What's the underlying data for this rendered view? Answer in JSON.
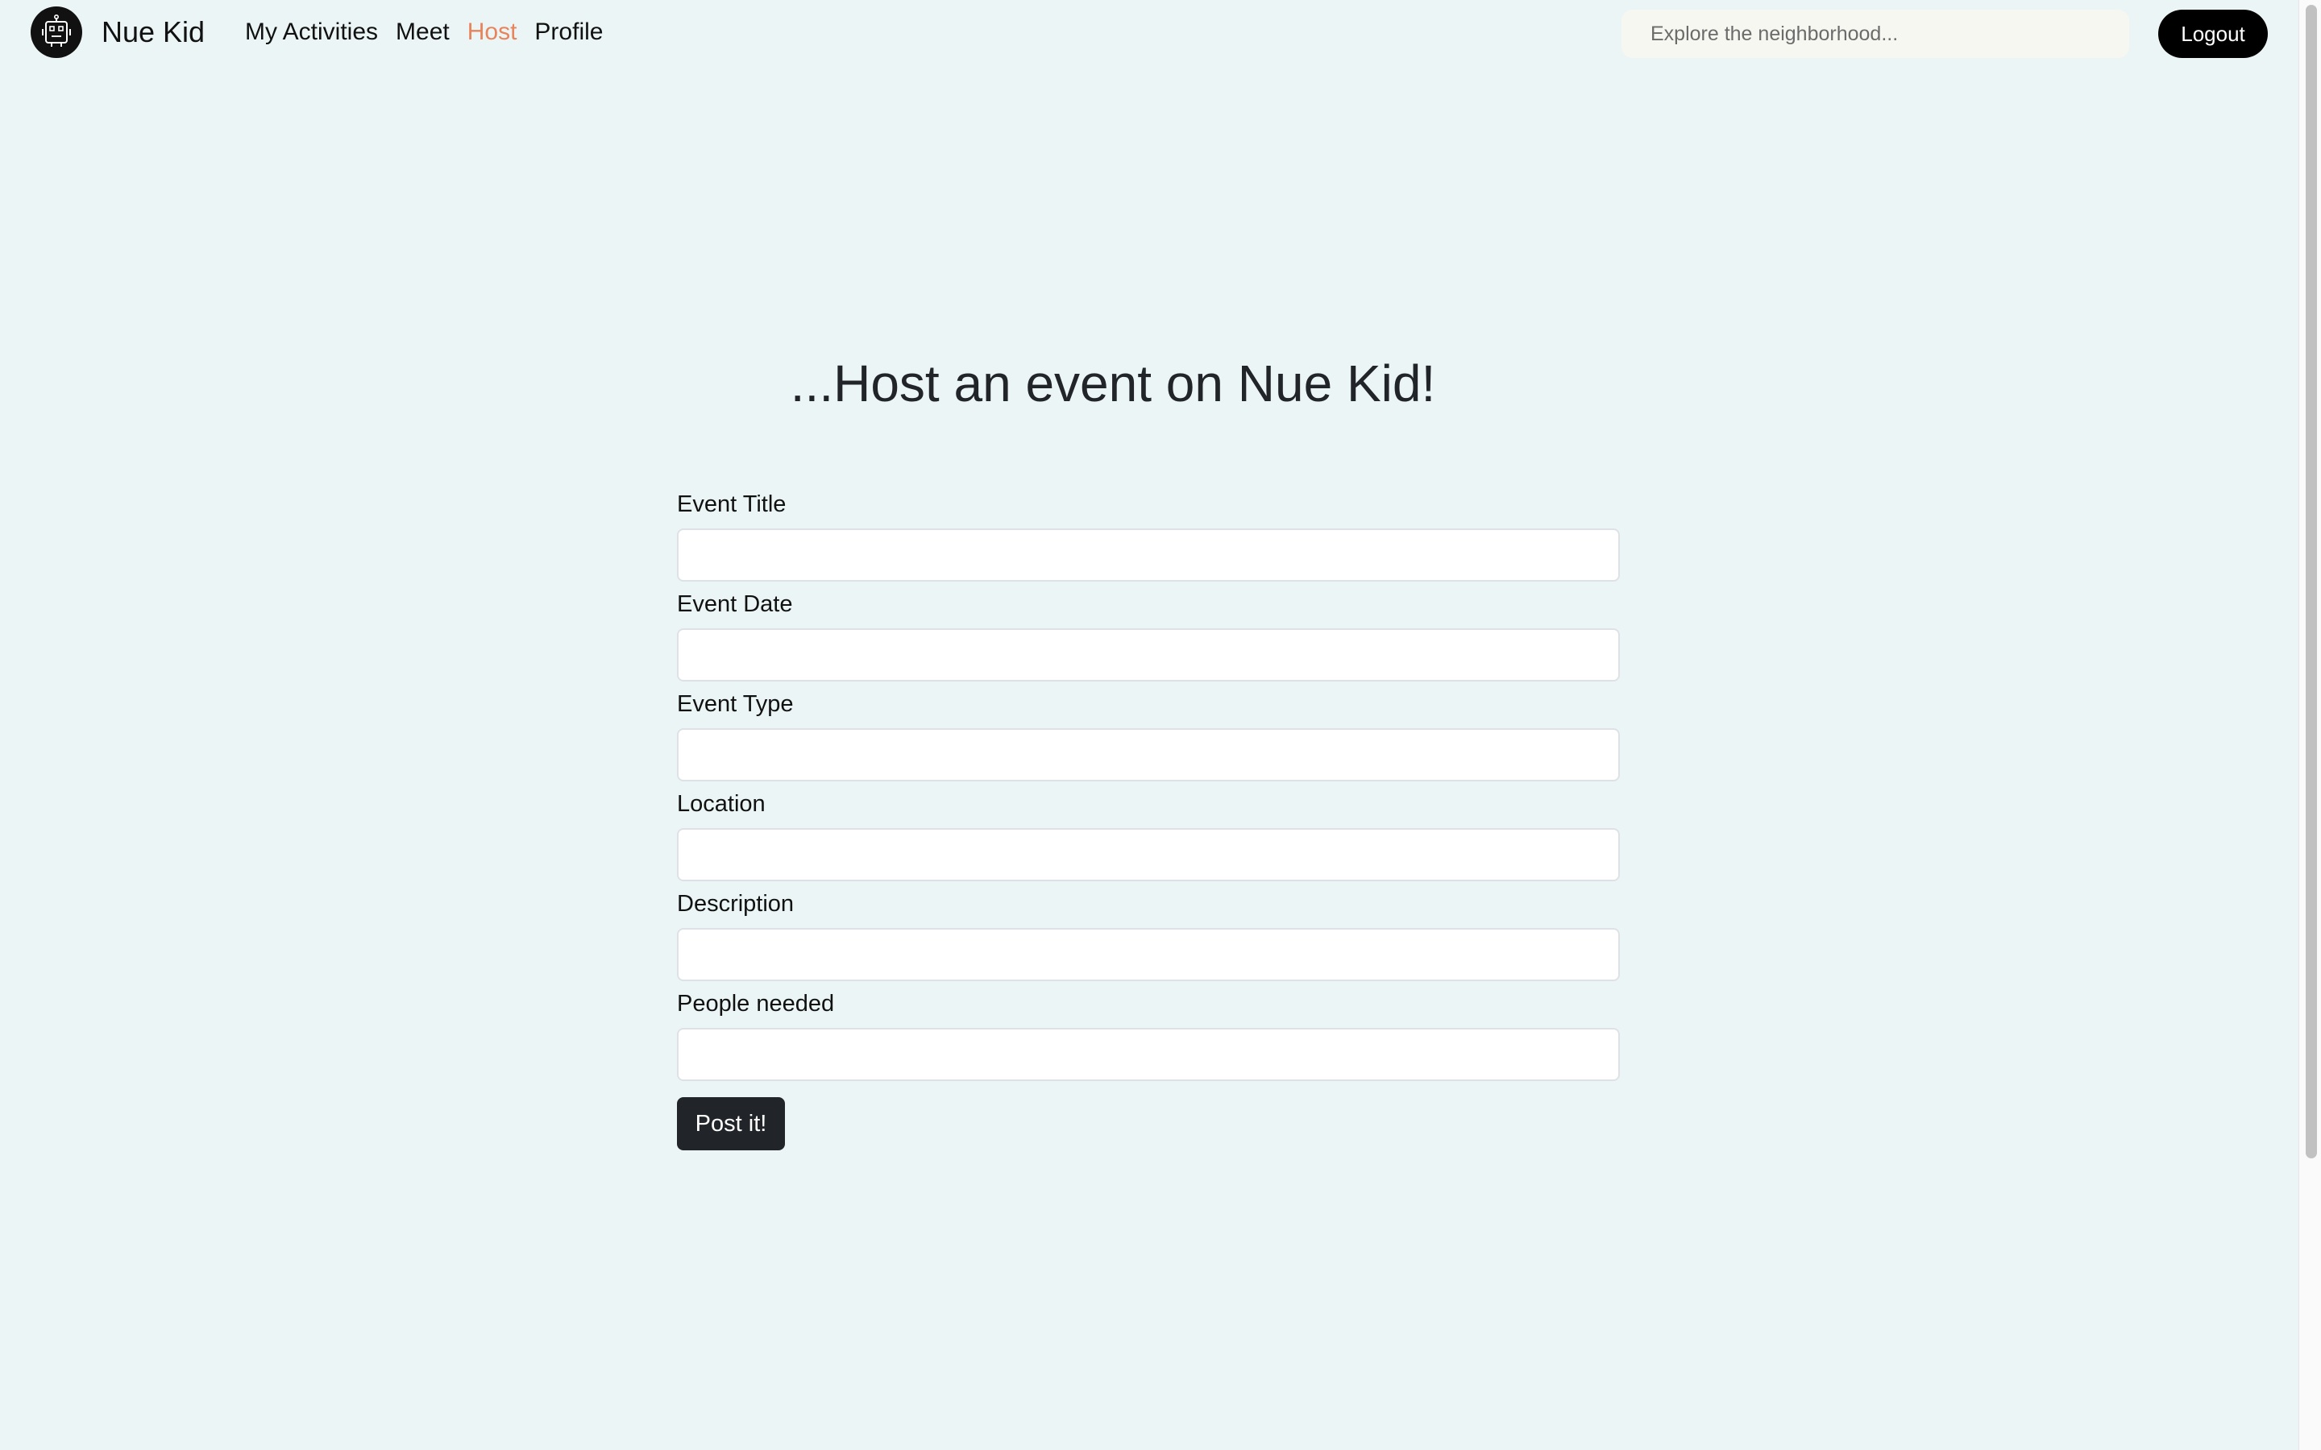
{
  "app": {
    "brand": "Nue Kid",
    "logo_icon": "robot-icon"
  },
  "nav": {
    "items": [
      {
        "label": "My Activities",
        "active": false
      },
      {
        "label": "Meet",
        "active": false
      },
      {
        "label": "Host",
        "active": true
      },
      {
        "label": "Profile",
        "active": false
      }
    ],
    "active_color": "#e8845c"
  },
  "search": {
    "placeholder": "Explore the neighborhood...",
    "value": ""
  },
  "logout": {
    "label": "Logout"
  },
  "heading": "...Host an event on Nue Kid!",
  "form": {
    "fields": [
      {
        "label": "Event Title",
        "value": ""
      },
      {
        "label": "Event Date",
        "value": ""
      },
      {
        "label": "Event Type",
        "value": ""
      },
      {
        "label": "Location",
        "value": ""
      },
      {
        "label": "Description",
        "value": ""
      },
      {
        "label": "People needed",
        "value": ""
      }
    ],
    "submit_label": "Post it!"
  },
  "colors": {
    "background": "#ecf5f5",
    "button_dark": "#212529",
    "logout_bg": "#000000"
  }
}
